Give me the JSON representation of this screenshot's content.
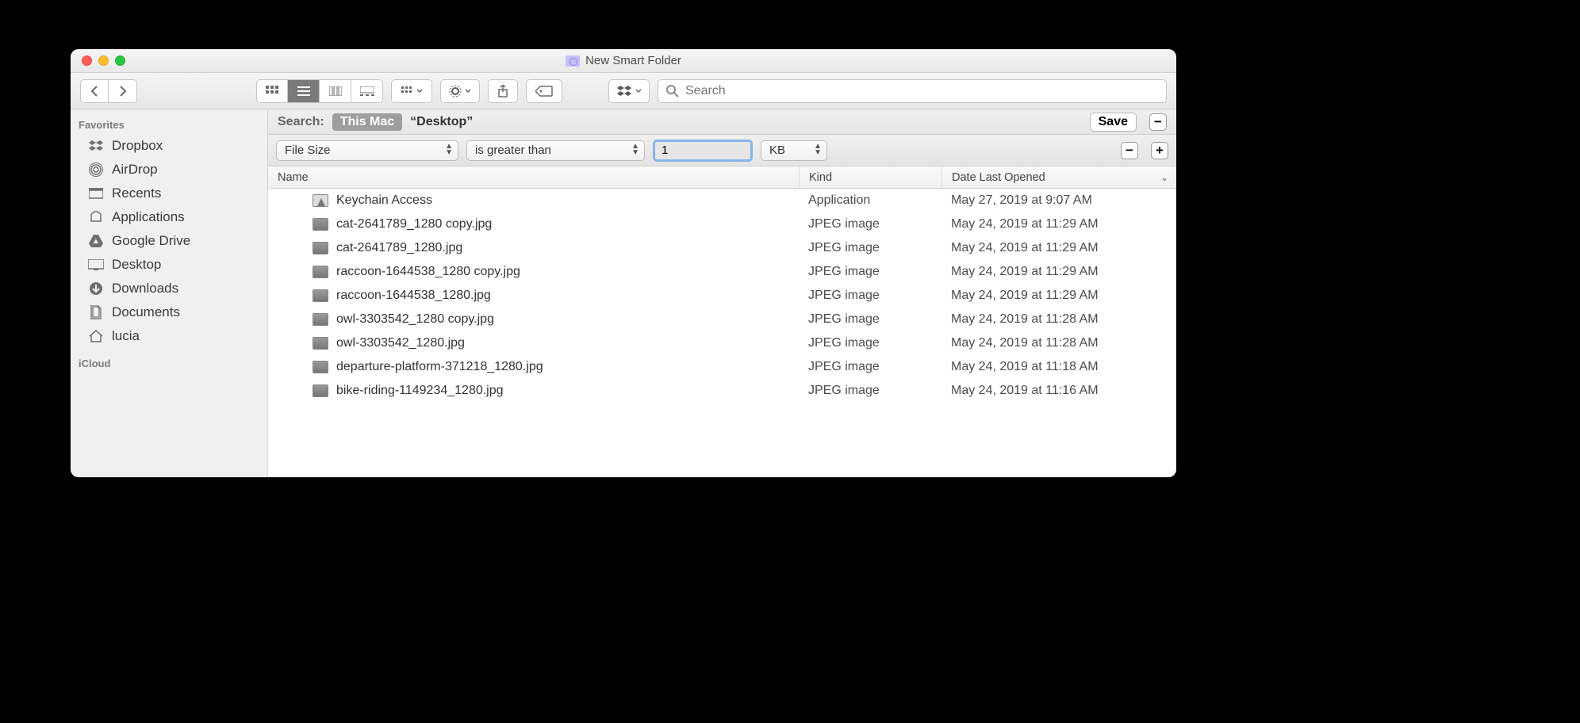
{
  "window": {
    "title": "New Smart Folder"
  },
  "search_placeholder": "Search",
  "sidebar": {
    "favorites_label": "Favorites",
    "icloud_label": "iCloud",
    "items": [
      {
        "label": "Dropbox"
      },
      {
        "label": "AirDrop"
      },
      {
        "label": "Recents"
      },
      {
        "label": "Applications"
      },
      {
        "label": "Google Drive"
      },
      {
        "label": "Desktop"
      },
      {
        "label": "Downloads"
      },
      {
        "label": "Documents"
      },
      {
        "label": "lucia"
      }
    ]
  },
  "scope": {
    "label": "Search:",
    "selected": "This Mac",
    "alt": "“Desktop”",
    "save": "Save"
  },
  "criteria": {
    "attribute": "File Size",
    "operator": "is greater than",
    "value": "1",
    "unit": "KB"
  },
  "columns": {
    "name": "Name",
    "kind": "Kind",
    "date": "Date Last Opened"
  },
  "rows": [
    {
      "name": "Keychain Access",
      "kind": "Application",
      "date": "May 27, 2019 at 9:07 AM",
      "type": "app"
    },
    {
      "name": "cat-2641789_1280 copy.jpg",
      "kind": "JPEG image",
      "date": "May 24, 2019 at 11:29 AM",
      "type": "img"
    },
    {
      "name": "cat-2641789_1280.jpg",
      "kind": "JPEG image",
      "date": "May 24, 2019 at 11:29 AM",
      "type": "img"
    },
    {
      "name": "raccoon-1644538_1280 copy.jpg",
      "kind": "JPEG image",
      "date": "May 24, 2019 at 11:29 AM",
      "type": "img"
    },
    {
      "name": "raccoon-1644538_1280.jpg",
      "kind": "JPEG image",
      "date": "May 24, 2019 at 11:29 AM",
      "type": "img"
    },
    {
      "name": "owl-3303542_1280 copy.jpg",
      "kind": "JPEG image",
      "date": "May 24, 2019 at 11:28 AM",
      "type": "img"
    },
    {
      "name": "owl-3303542_1280.jpg",
      "kind": "JPEG image",
      "date": "May 24, 2019 at 11:28 AM",
      "type": "img"
    },
    {
      "name": "departure-platform-371218_1280.jpg",
      "kind": "JPEG image",
      "date": "May 24, 2019 at 11:18 AM",
      "type": "img"
    },
    {
      "name": "bike-riding-1149234_1280.jpg",
      "kind": "JPEG image",
      "date": "May 24, 2019 at 11:16 AM",
      "type": "img"
    }
  ]
}
